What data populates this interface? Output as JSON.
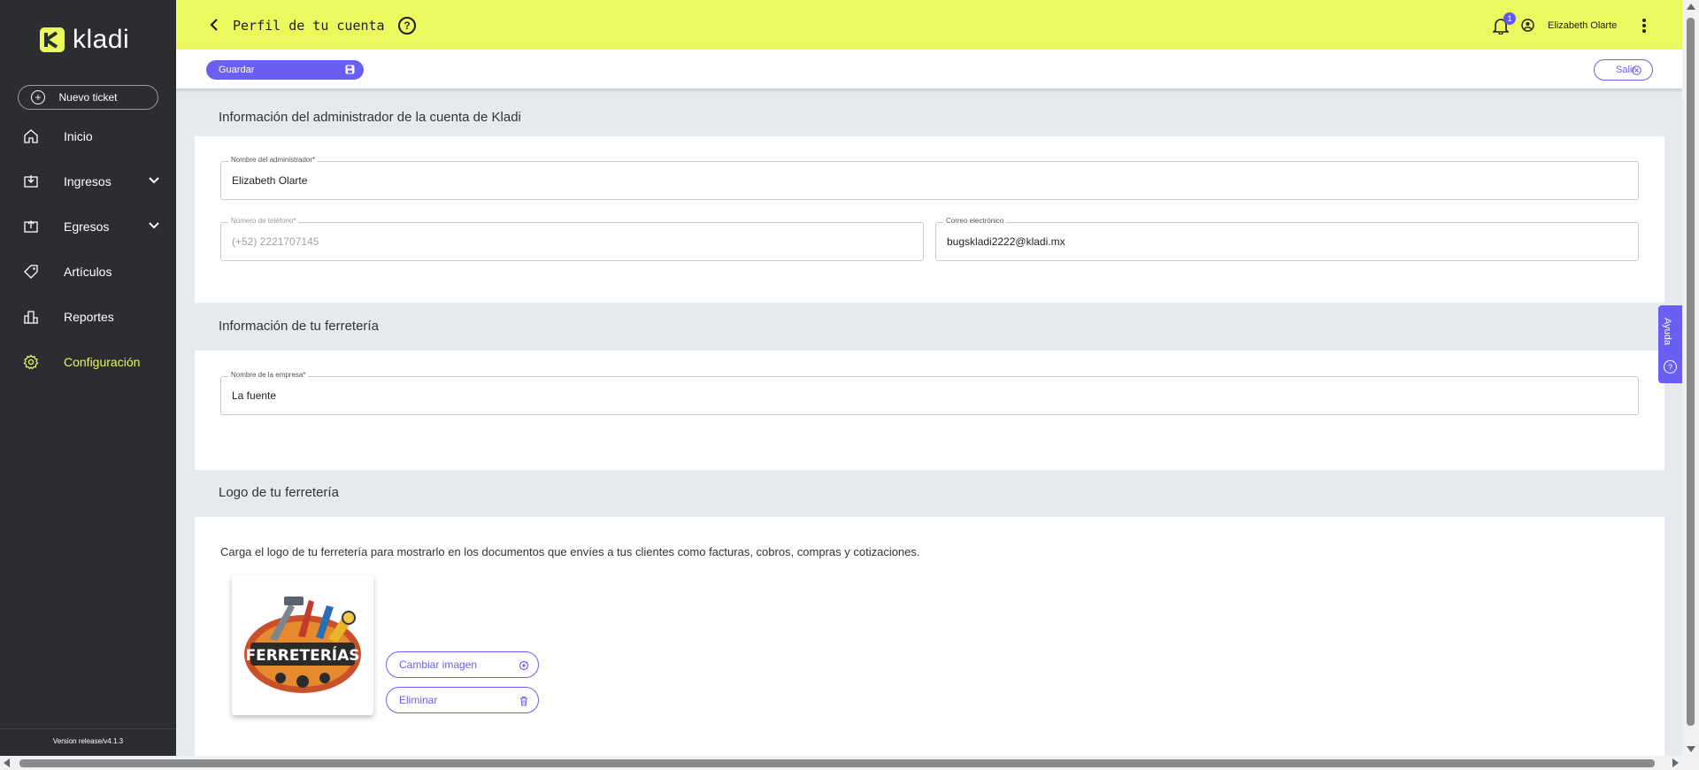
{
  "brand": {
    "name": "kladi",
    "accent": "#EBF95F",
    "primary": "#6A5FF5",
    "sidebar_bg": "#2B2D30"
  },
  "sidebar": {
    "new_ticket": "Nuevo ticket",
    "items": [
      {
        "label": "Inicio",
        "icon": "home-icon"
      },
      {
        "label": "Ingresos",
        "icon": "income-icon"
      },
      {
        "label": "Egresos",
        "icon": "expense-icon"
      },
      {
        "label": "Artículos",
        "icon": "tag-icon"
      },
      {
        "label": "Reportes",
        "icon": "reports-icon"
      },
      {
        "label": "Configuración",
        "icon": "gear-icon",
        "active": true
      }
    ],
    "version": "Version release/v4.1.3"
  },
  "header": {
    "title": "Perfil de tu cuenta",
    "notifications": "1",
    "user": "Elizabeth Olarte"
  },
  "toolbar": {
    "save": "Guardar",
    "exit": "Salir"
  },
  "admin": {
    "section_title": "Información del administrador de la cuenta de Kladi",
    "name_label": "Nombre del administrador*",
    "name_value": "Elizabeth Olarte",
    "phone_label": "Número de teléfono*",
    "phone_placeholder": "(+52) 2221707145",
    "email_label": "Correo electrónico",
    "email_value": "bugskladi2222@kladi.mx"
  },
  "store": {
    "section_title": "Información de tu ferretería",
    "company_label": "Nombre de la empresa*",
    "company_value": "La fuente"
  },
  "logo": {
    "section_title": "Logo de tu ferretería",
    "description": "Carga el logo de tu ferretería para mostrarlo en los documentos que envíes a tus clientes como facturas, cobros, compras y cotizaciones.",
    "image_text": "FERRETERÍAS",
    "change_button": "Cambiar imagen",
    "delete_button": "Eliminar"
  },
  "help_tab": "Ayuda"
}
